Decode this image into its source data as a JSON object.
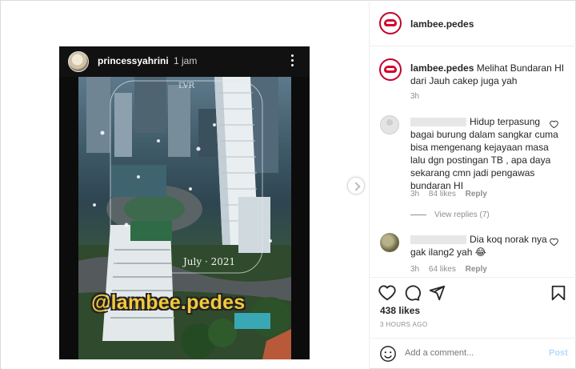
{
  "story": {
    "username": "princessyahrini",
    "time": "1 jam",
    "watermark": "@lambee.pedes",
    "video_caption": "July · 2021"
  },
  "post": {
    "username": "lambee.pedes",
    "caption_text": "Melihat Bundaran HI dari Jauh cakep juga yah",
    "caption_time": "3h"
  },
  "comments": [
    {
      "text": "Hidup terpasung bagai burung dalam sangkar cuma bisa mengenang kejayaan masa lalu dgn postingan TB , apa daya sekarang cmn jadi pengawas bundaran HI",
      "time": "3h",
      "likes": "84 likes",
      "reply": "Reply",
      "view_replies": "View replies (7)"
    },
    {
      "text": "Dia koq norak nya gak ilang2 yah 😂",
      "time": "3h",
      "likes": "64 likes",
      "reply": "Reply"
    }
  ],
  "stats": {
    "likes": "438 likes",
    "posted": "3 HOURS AGO"
  },
  "comment_box": {
    "placeholder": "Add a comment...",
    "post_label": "Post"
  },
  "icons": {
    "like": "heart-icon",
    "comment": "comment-icon",
    "share": "share-icon",
    "save": "bookmark-icon",
    "emoji": "emoji-icon"
  },
  "colors": {
    "brand_red": "#d6002d",
    "watermark_yellow": "#f3c93b",
    "muted": "#8e8e8e",
    "post_blue": "#b3dbff"
  }
}
